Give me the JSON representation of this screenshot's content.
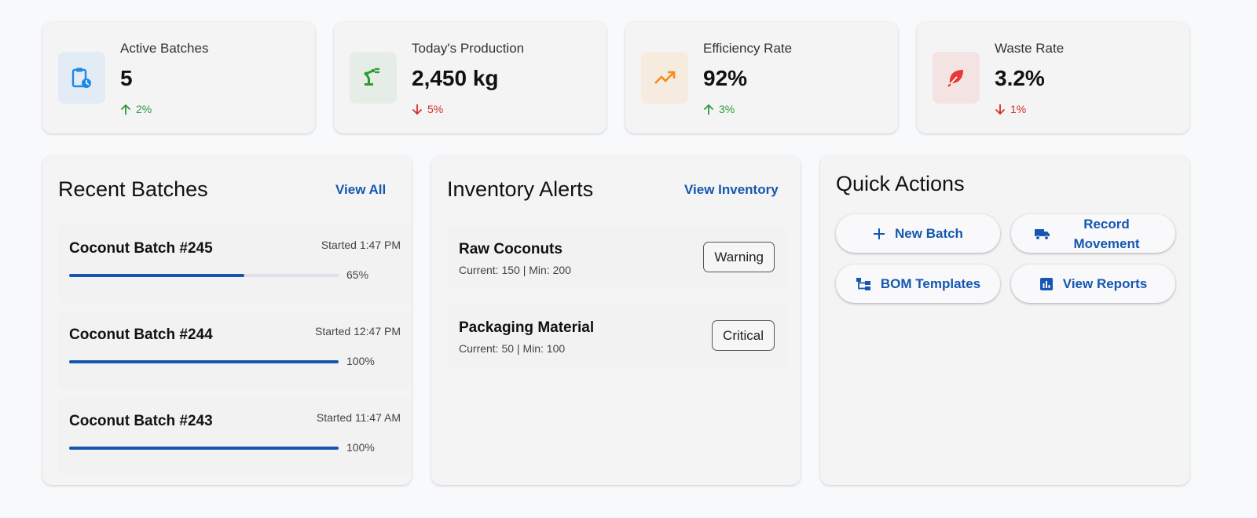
{
  "stats": [
    {
      "title": "Active Batches",
      "value": "5",
      "trend": "2%",
      "direction": "up",
      "icon": "clipboard-clock-icon",
      "bg": "#e3ebf5",
      "color": "#1e88e5"
    },
    {
      "title": "Today's Production",
      "value": "2,450 kg",
      "trend": "5%",
      "direction": "down",
      "icon": "precision-manufacturing-icon",
      "bg": "#e6ede7",
      "color": "#2e9a36"
    },
    {
      "title": "Efficiency Rate",
      "value": "92%",
      "trend": "3%",
      "direction": "up",
      "icon": "trending-up-icon",
      "bg": "#f6ebdf",
      "color": "#f28c1a"
    },
    {
      "title": "Waste Rate",
      "value": "3.2%",
      "trend": "1%",
      "direction": "down",
      "icon": "eco-leaf-icon",
      "bg": "#f4e3e3",
      "color": "#e53935"
    }
  ],
  "recent_batches": {
    "title": "Recent Batches",
    "view_all": "View All",
    "items": [
      {
        "name": "Coconut Batch #245",
        "started": "Started 1:47 PM",
        "progress": 65,
        "progress_label": "65%"
      },
      {
        "name": "Coconut Batch #244",
        "started": "Started 12:47 PM",
        "progress": 100,
        "progress_label": "100%"
      },
      {
        "name": "Coconut Batch #243",
        "started": "Started 11:47 AM",
        "progress": 100,
        "progress_label": "100%"
      }
    ]
  },
  "inventory_alerts": {
    "title": "Inventory Alerts",
    "view_inventory": "View Inventory",
    "items": [
      {
        "name": "Raw Coconuts",
        "detail": "Current: 150 | Min: 200",
        "status": "Warning"
      },
      {
        "name": "Packaging Material",
        "detail": "Current: 50 | Min: 100",
        "status": "Critical"
      }
    ]
  },
  "quick_actions": {
    "title": "Quick Actions",
    "buttons": [
      {
        "label": "New Batch",
        "icon": "plus-icon"
      },
      {
        "label": "Record Movement",
        "icon": "truck-icon"
      },
      {
        "label": "BOM Templates",
        "icon": "hierarchy-icon"
      },
      {
        "label": "View Reports",
        "icon": "bar-chart-icon"
      }
    ]
  },
  "colors": {
    "accent": "#1557b0",
    "up": "#2e9a36",
    "down": "#d32f2f"
  }
}
